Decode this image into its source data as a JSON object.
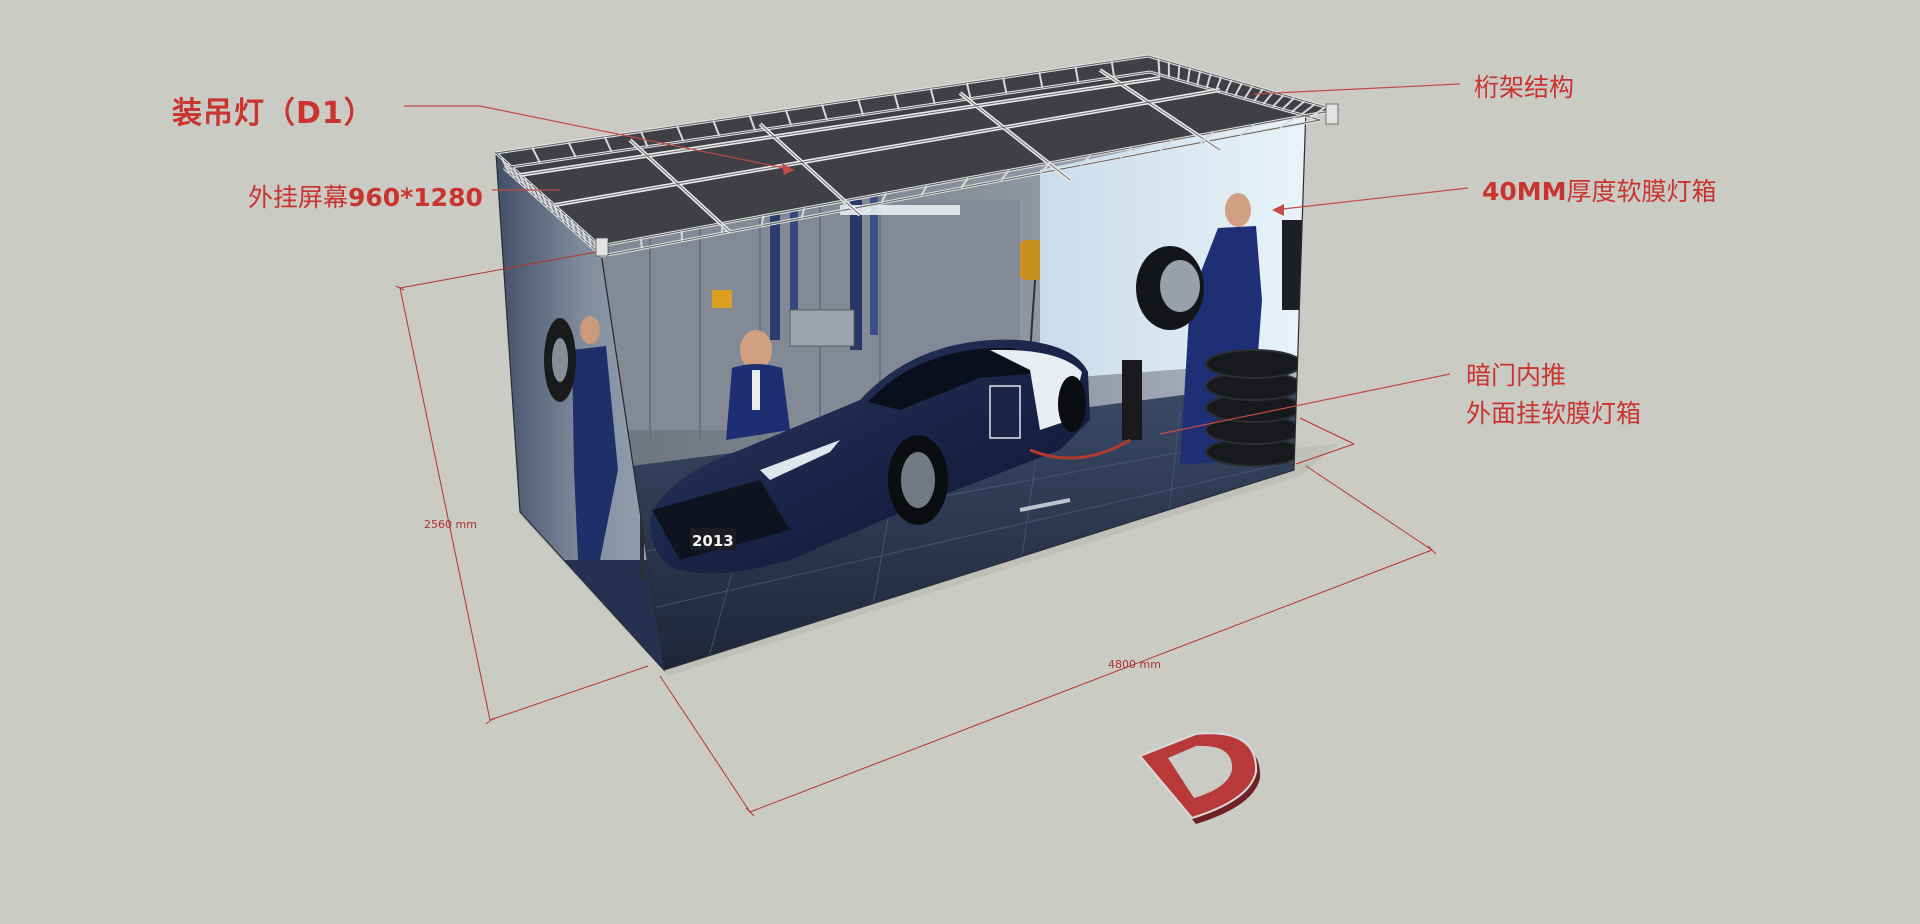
{
  "labels": {
    "hanging_light": "装吊灯（D1）",
    "screen_prefix": "外挂屏幕",
    "screen_size": "960*1280",
    "truss": "桁架结构",
    "lightbox_prefix": "40MM",
    "lightbox_suffix": "厚度软膜灯箱",
    "door_line1": "暗门内推",
    "door_line2": "外面挂软膜灯箱"
  },
  "dimensions": {
    "height": "2560 mm",
    "length": "4800 mm"
  },
  "booth_letter": "D",
  "graphic": {
    "car_plate": "2013"
  },
  "colors": {
    "background": "#cbcbc6",
    "annotation": "#c9342f",
    "letter_face": "#b8393a",
    "letter_side": "#6e2224"
  }
}
